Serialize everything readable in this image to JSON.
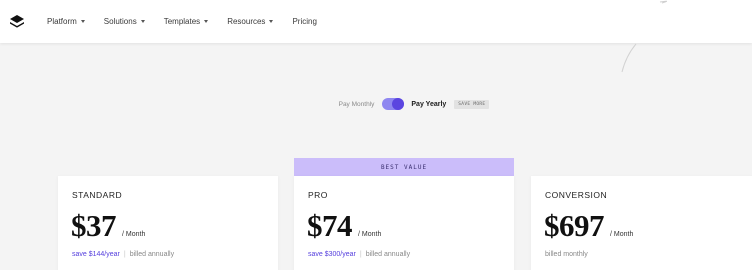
{
  "header": {
    "logo_icon": "layers-icon",
    "nav": [
      {
        "label": "Platform",
        "dropdown": true
      },
      {
        "label": "Solutions",
        "dropdown": true
      },
      {
        "label": "Templates",
        "dropdown": true
      },
      {
        "label": "Resources",
        "dropdown": true
      },
      {
        "label": "Pricing",
        "dropdown": false
      }
    ]
  },
  "billing": {
    "monthly_label": "Pay Monthly",
    "yearly_label": "Pay Yearly",
    "save_badge": "SAVE MORE",
    "yearly_selected": true
  },
  "plans": [
    {
      "name": "STANDARD",
      "price": "$37",
      "period": "/ Month",
      "save_text": "save $144/year",
      "separator": "|",
      "billing_text": "billed annually"
    },
    {
      "badge": "BEST VALUE",
      "name": "PRO",
      "price": "$74",
      "period": "/ Month",
      "save_text": "save $300/year",
      "separator": "|",
      "billing_text": "billed annually"
    },
    {
      "name": "CONVERSION",
      "price": "$697",
      "period": "/ Month",
      "billing_text": "billed monthly"
    }
  ],
  "colors": {
    "accent": "#5640de",
    "toggle_track": "#8f87f0",
    "best_value_bg": "#cbbdfa",
    "page_bg": "#f4f4f4"
  }
}
